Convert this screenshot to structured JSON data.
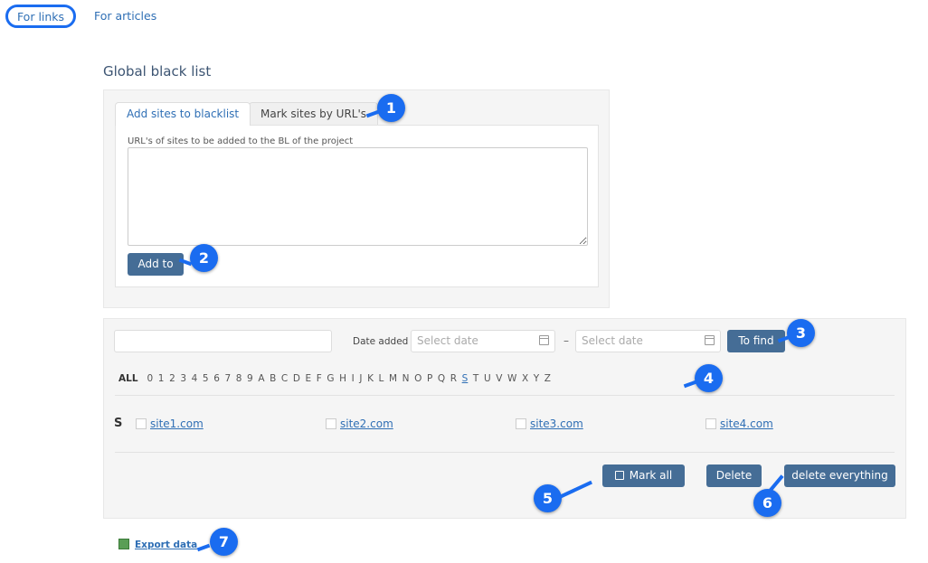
{
  "top_tabs": {
    "links": "For links",
    "articles": "For articles"
  },
  "title": "Global black list",
  "tabs": {
    "add": "Add sites to blacklist",
    "mark": "Mark sites by URL's"
  },
  "form": {
    "label": "URL's of sites to be added to the BL of the project",
    "add_button": "Add to"
  },
  "search": {
    "date_label": "Date added",
    "date_from_placeholder": "Select date",
    "date_to_placeholder": "Select date",
    "separator": "–",
    "find_button": "To find"
  },
  "alphabet": [
    "ALL",
    "0",
    "1",
    "2",
    "3",
    "4",
    "5",
    "6",
    "7",
    "8",
    "9",
    "A",
    "B",
    "C",
    "D",
    "E",
    "F",
    "G",
    "H",
    "I",
    "J",
    "K",
    "L",
    "M",
    "N",
    "O",
    "P",
    "Q",
    "R",
    "S",
    "T",
    "U",
    "V",
    "W",
    "X",
    "Y",
    "Z"
  ],
  "alphabet_active": "S",
  "group_letter": "S",
  "sites": [
    "site1.com",
    "site2.com",
    "site3.com",
    "site4.com"
  ],
  "actions": {
    "mark_all": "Mark all",
    "delete": "Delete",
    "delete_all": "delete everything"
  },
  "export": "Export data",
  "callouts": [
    "1",
    "2",
    "3",
    "4",
    "5",
    "6",
    "7"
  ],
  "accent_color": "#1a6cf0",
  "button_color": "#456d96"
}
